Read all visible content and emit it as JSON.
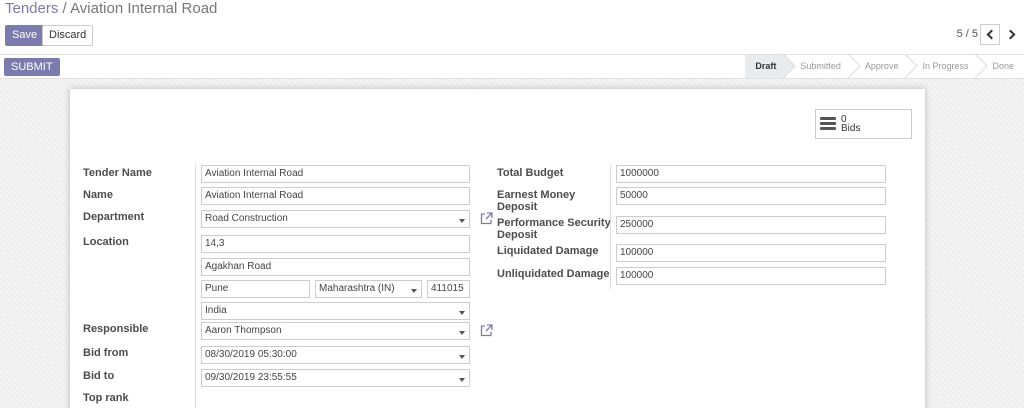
{
  "breadcrumb": {
    "parent": "Tenders",
    "separator": "/",
    "current": "Aviation Internal Road"
  },
  "toolbar": {
    "save_label": "Save",
    "discard_label": "Discard",
    "pager": "5 / 5"
  },
  "statusbar": {
    "submit_label": "SUBMIT",
    "stages": [
      "Draft",
      "Submitted",
      "Approve",
      "In Progress",
      "Done"
    ],
    "active_stage": "Draft"
  },
  "smart_button": {
    "count": "0",
    "label": "Bids",
    "icon": "bars-icon"
  },
  "form": {
    "left": {
      "tender_name_label": "Tender Name",
      "tender_name": "Aviation Internal Road",
      "name_label": "Name",
      "name": "Aviation Internal Road",
      "department_label": "Department",
      "department": "Road Construction",
      "location_label": "Location",
      "street": "14,3",
      "street2": "Agakhan Road",
      "city": "Pune",
      "state": "Maharashtra (IN)",
      "zip": "411015",
      "country": "India",
      "responsible_label": "Responsible",
      "responsible": "Aaron Thompson",
      "bid_from_label": "Bid from",
      "bid_from": "08/30/2019 05:30:00",
      "bid_to_label": "Bid to",
      "bid_to": "09/30/2019 23:55:55",
      "top_rank_label": "Top rank"
    },
    "right": {
      "total_budget_label": "Total Budget",
      "total_budget": "1000000",
      "earnest_money_label_1": "Earnest Money",
      "earnest_money_label_2": "Deposit",
      "earnest_money": "50000",
      "performance_label_1": "Performance Security",
      "performance_label_2": "Deposit",
      "performance": "250000",
      "liquidated_label": "Liquidated Damage",
      "liquidated": "100000",
      "unliquidated_label": "Unliquidated Damage",
      "unliquidated": "100000"
    }
  },
  "colors": {
    "primary": "#7c7bad",
    "label": "#4c4c4c",
    "border": "#cccccc"
  }
}
